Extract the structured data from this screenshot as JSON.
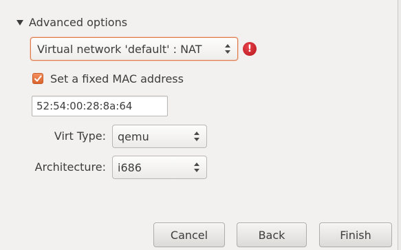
{
  "advanced": {
    "label": "Advanced options",
    "expanded": true
  },
  "network": {
    "selected": "Virtual network 'default' : NAT",
    "error_icon": "error-icon",
    "error_glyph": "!"
  },
  "mac": {
    "checkbox_label": "Set a fixed MAC address",
    "checked": true,
    "value": "52:54:00:28:8a:64"
  },
  "virt_type": {
    "label": "Virt Type:",
    "selected": "qemu"
  },
  "architecture": {
    "label": "Architecture:",
    "selected": "i686"
  },
  "buttons": {
    "cancel": "Cancel",
    "back": "Back",
    "finish": "Finish"
  },
  "colors": {
    "accent": "#dd6b33",
    "error": "#c4161c",
    "background": "#f2f1f0"
  }
}
